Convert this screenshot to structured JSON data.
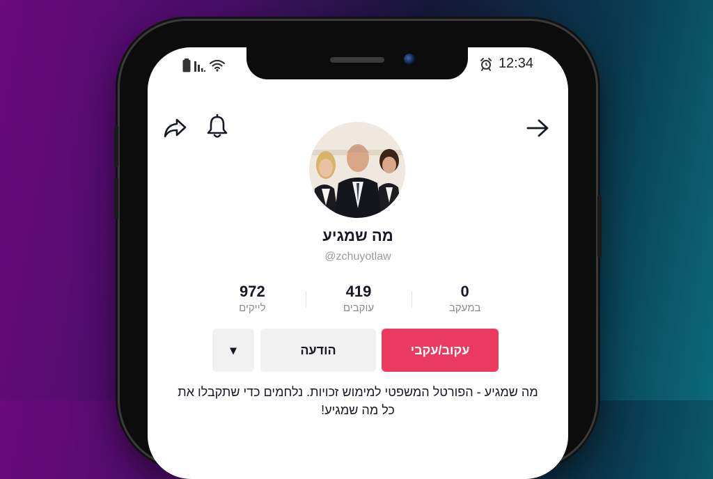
{
  "status_bar": {
    "time": "12:34",
    "icons": [
      "battery-icon",
      "signal-icon",
      "wifi-icon",
      "alarm-icon"
    ]
  },
  "top_bar": {
    "icons": [
      "share-icon",
      "bell-icon",
      "back-arrow-icon"
    ]
  },
  "profile": {
    "name": "מה שמגיע",
    "handle": "@zchuyotlaw",
    "stats": [
      {
        "value": "972",
        "label": "לייקים"
      },
      {
        "value": "419",
        "label": "עוקבים"
      },
      {
        "value": "0",
        "label": "במעקב"
      }
    ],
    "buttons": {
      "more_icon": "▾",
      "message": "הודעה",
      "follow": "עקוב/עקבי"
    },
    "bio": "מה שמגיע - הפורטל המשפטי למימוש זכויות. נלחמים כדי שתקבלו את כל מה שמגיע!"
  },
  "colors": {
    "accent": "#ea3a5f",
    "text": "#161823",
    "muted": "#8a8b91"
  }
}
